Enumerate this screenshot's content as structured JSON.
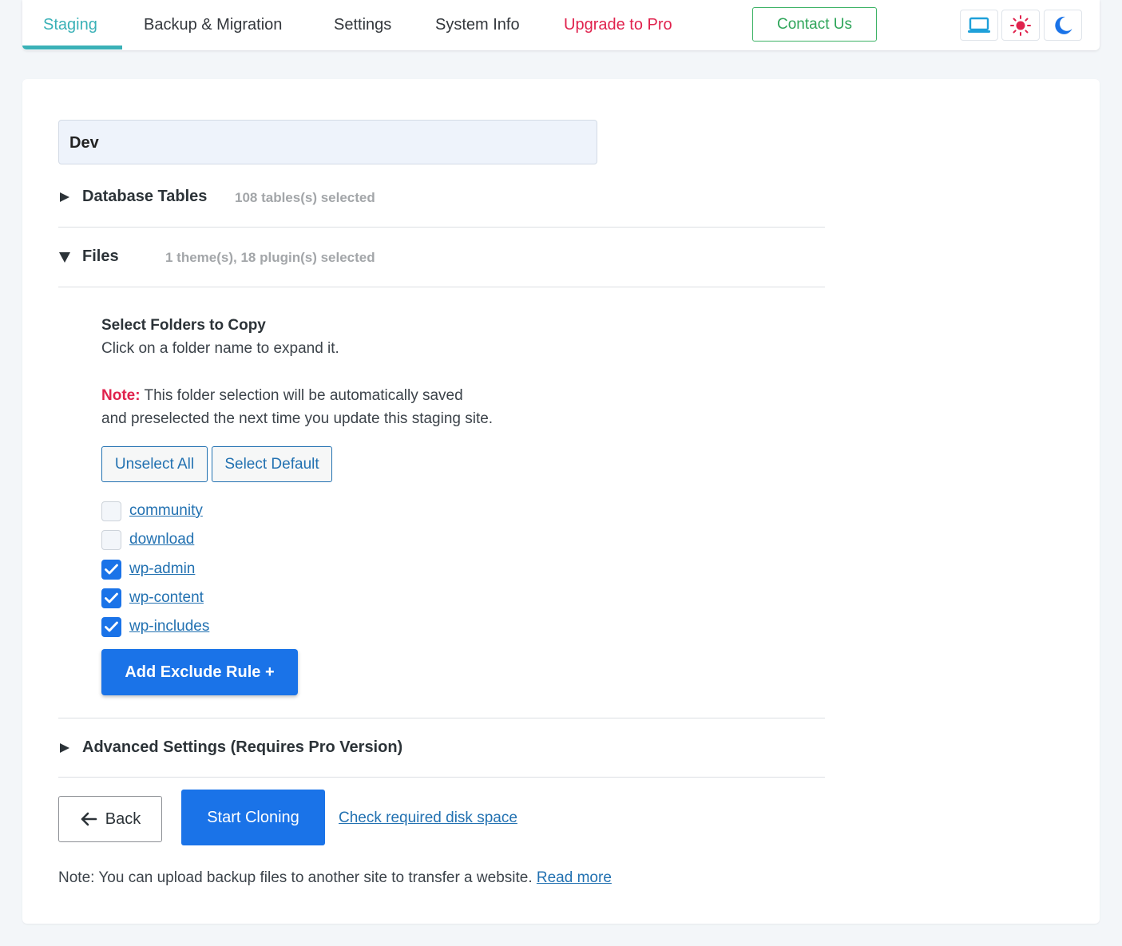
{
  "nav": {
    "tabs": [
      {
        "label": "Staging",
        "active": true
      },
      {
        "label": "Backup & Migration"
      },
      {
        "label": "Settings"
      },
      {
        "label": "System Info"
      },
      {
        "label": "Upgrade to Pro"
      }
    ],
    "contact_label": "Contact Us",
    "mode_buttons": [
      "laptop-icon",
      "sun-icon",
      "moon-icon"
    ]
  },
  "clone": {
    "site_name": "Dev",
    "sections": {
      "database": {
        "title": "Database Tables",
        "meta": "108 tables(s) selected",
        "expanded": false
      },
      "files": {
        "title": "Files",
        "meta": "1 theme(s), 18 plugin(s) selected",
        "expanded": true
      },
      "advanced": {
        "title": "Advanced Settings (Requires Pro Version)",
        "expanded": false
      }
    },
    "folders": {
      "heading": "Select Folders to Copy",
      "hint": "Click on a folder name to expand it.",
      "note_label": "Note:",
      "note_line1": "This folder selection will be automatically saved",
      "note_line2": "and preselected the next time you update this staging site.",
      "unselect_all": "Unselect All",
      "select_default": "Select Default",
      "items": [
        {
          "name": "community",
          "checked": false
        },
        {
          "name": "download",
          "checked": false
        },
        {
          "name": "wp-admin",
          "checked": true
        },
        {
          "name": "wp-content",
          "checked": true
        },
        {
          "name": "wp-includes",
          "checked": true
        }
      ],
      "add_exclude_rule": "Add Exclude Rule +"
    },
    "actions": {
      "back": "Back",
      "start": "Start Cloning",
      "check_disk": "Check required disk space"
    },
    "footer": {
      "note": "Note: You can upload backup files to another site to transfer a website.",
      "read_more": "Read more"
    }
  },
  "colors": {
    "accent_teal": "#3ab1b7",
    "pro_red": "#e0224d",
    "contact_green": "#2fa55a",
    "primary_blue": "#1a73e8",
    "link_blue": "#2271b1"
  }
}
